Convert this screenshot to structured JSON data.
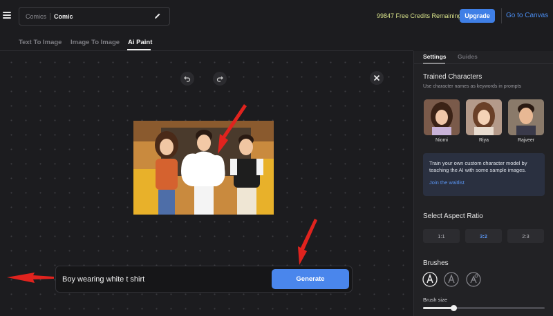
{
  "header": {
    "breadcrumb": "Comics",
    "doc_name": "Comic",
    "credits": "99847 Free Credits Remaining",
    "upgrade_label": "Upgrade",
    "canvas_link": "Go to Canvas"
  },
  "tabs": [
    {
      "label": "Text To Image",
      "active": false
    },
    {
      "label": "Image To Image",
      "active": false
    },
    {
      "label": "Ai Paint",
      "active": true
    }
  ],
  "prompt": {
    "text": "Boy wearing white t shirt",
    "generate_label": "Generate"
  },
  "side_tabs": [
    {
      "label": "Settings",
      "active": true
    },
    {
      "label": "Guides",
      "active": false
    }
  ],
  "trained": {
    "title": "Trained Characters",
    "subtitle": "Use character names as keywords in prompts",
    "characters": [
      "Niomi",
      "Riya",
      "Rajveer"
    ]
  },
  "train_card": {
    "text": "Train your own custom character model by teaching the AI with some sample images.",
    "link": "Join the waitlist"
  },
  "aspect": {
    "title": "Select Aspect Ratio",
    "options": [
      "1:1",
      "3:2",
      "2:3"
    ],
    "selected": "3:2"
  },
  "brushes": {
    "title": "Brushes",
    "size_label": "Brush size",
    "size_fraction": 0.25
  },
  "colors": {
    "accent": "#4a86ec",
    "credits": "#d8e28a",
    "annotation": "#e0231e"
  }
}
